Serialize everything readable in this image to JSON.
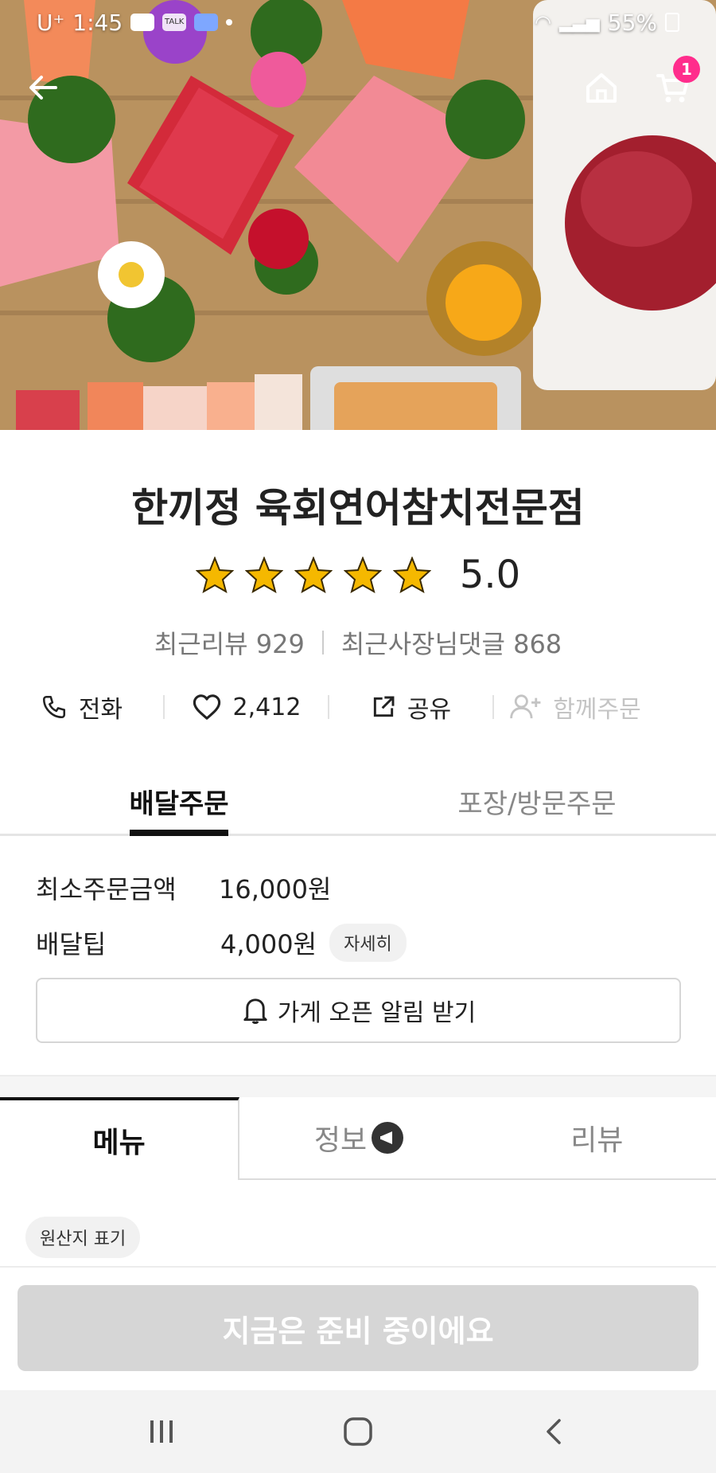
{
  "status_bar": {
    "time": "1:45",
    "carrier": "U⁺",
    "battery": "55%",
    "talk_label": "TALK"
  },
  "header": {
    "cart_count": "1"
  },
  "store": {
    "name": "한끼정 육회연어참치전문점",
    "rating": "5.0",
    "stars": 5,
    "recent_reviews": "최근리뷰 929",
    "owner_replies": "최근사장님댓글 868"
  },
  "actions": {
    "call": "전화",
    "likes": "2,412",
    "share": "공유",
    "group_order": "함께주문"
  },
  "order_tabs": {
    "delivery": "배달주문",
    "pickup": "포장/방문주문"
  },
  "delivery_info": {
    "min_order_label": "최소주문금액",
    "min_order_value": "16,000원",
    "tip_label": "배달팁",
    "tip_value": "4,000원",
    "detail_label": "자세히"
  },
  "notify_button": "가게 오픈 알림 받기",
  "menu_tabs": {
    "menu": "메뉴",
    "info": "정보",
    "reviews": "리뷰"
  },
  "origin_label": "원산지 표기",
  "cta_label": "지금은 준비 중이에요",
  "colors": {
    "badge": "#ff2d8c",
    "star": "#f5b800",
    "cta_disabled": "#d6d6d6"
  }
}
